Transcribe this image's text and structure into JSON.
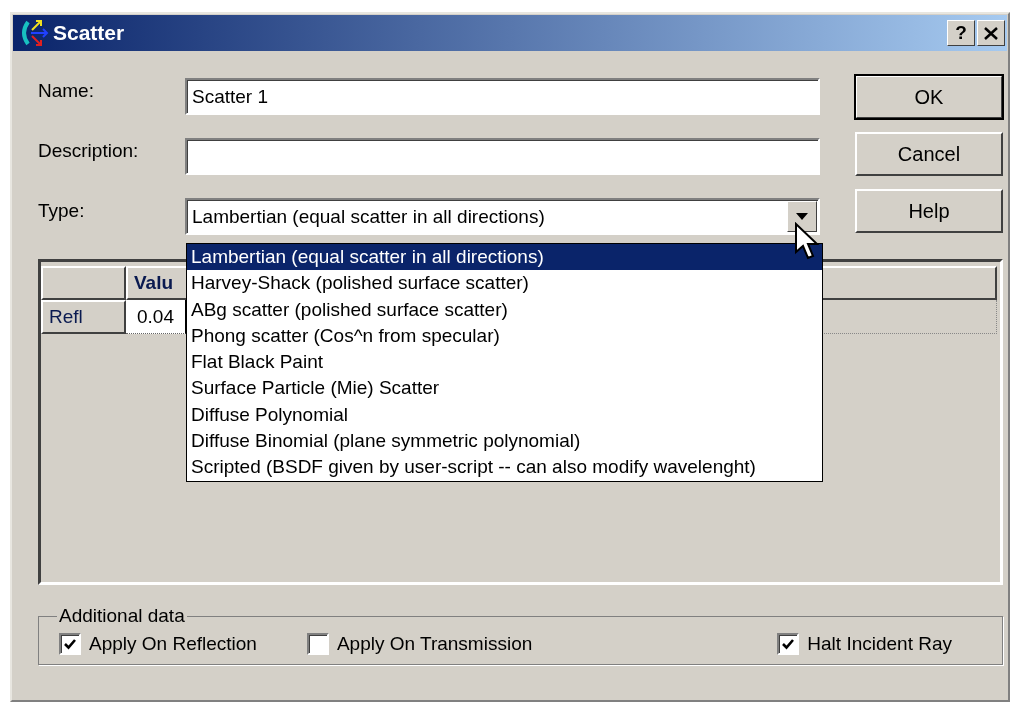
{
  "window": {
    "title": "Scatter",
    "help_button": "?"
  },
  "fields": [
    {
      "label": "Name:",
      "value": "Scatter 1"
    },
    {
      "label": "Description:"
    }
  ],
  "type": {
    "label": "Type:",
    "value": "Lambertian (equal scatter in all directions)",
    "expanded": true,
    "options": [
      {
        "label": "Lambertian (equal scatter in all directions)",
        "selected": true
      },
      {
        "label": "Harvey-Shack (polished surface scatter)",
        "selected": false
      },
      {
        "label": "ABg scatter (polished surface scatter)",
        "selected": false
      },
      {
        "label": "Phong scatter (Cos^n from specular)",
        "selected": false
      },
      {
        "label": "Flat Black Paint",
        "selected": false
      },
      {
        "label": "Surface Particle (Mie) Scatter",
        "selected": false
      },
      {
        "label": "Diffuse Polynomial",
        "selected": false
      },
      {
        "label": "Diffuse Binomial (plane symmetric polynomial)",
        "selected": false
      },
      {
        "label": "Scripted (BSDF given by user-script -- can also modify wavelenght)",
        "selected": false
      }
    ]
  },
  "buttons": [
    {
      "label": "OK",
      "default": true
    },
    {
      "label": "Cancel",
      "default": false
    },
    {
      "label": "Help",
      "default": false
    }
  ],
  "grid": {
    "columns": [
      "Valu"
    ],
    "rows": [
      {
        "header": "Refl",
        "cells": [
          "0.04"
        ]
      }
    ]
  },
  "additional_data": {
    "title": "Additional data",
    "checkboxes": [
      {
        "label": "Apply On Reflection",
        "checked": true
      },
      {
        "label": "Apply On Transmission",
        "checked": false
      },
      {
        "label": "Halt Incident Ray",
        "checked": true
      }
    ]
  }
}
